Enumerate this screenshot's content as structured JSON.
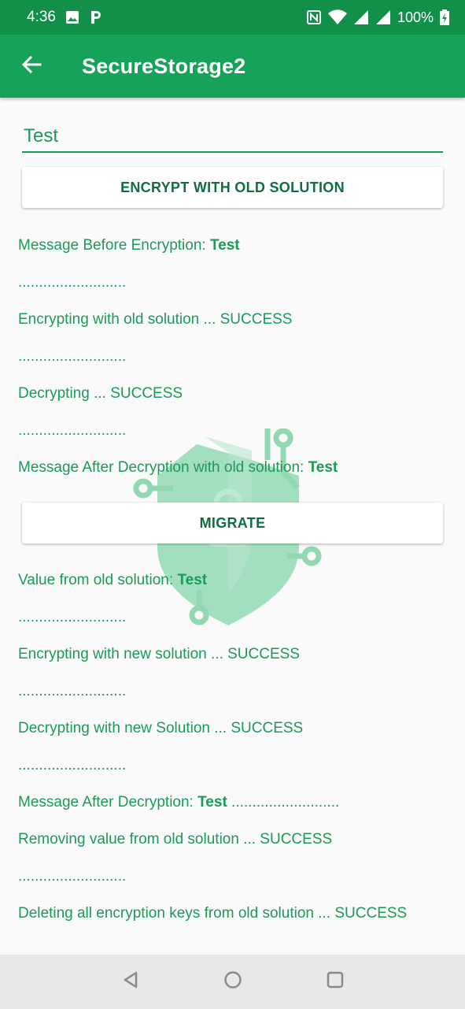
{
  "status_bar": {
    "time": "4:36",
    "battery": "100%",
    "icons": [
      "image-icon",
      "p-app-icon",
      "nfc-icon",
      "wifi-icon",
      "signal-icon",
      "signal-icon-2",
      "battery-icon"
    ]
  },
  "app_bar": {
    "title": "SecureStorage2",
    "back_icon": "arrow-back-icon"
  },
  "input": {
    "value": "Test"
  },
  "buttons": {
    "encrypt_old": "ENCRYPT WITH OLD SOLUTION",
    "migrate": "MIGRATE"
  },
  "log": {
    "line1_prefix": "Message Before Encryption: ",
    "line1_value": "Test",
    "sep": "..........................",
    "line2": "Encrypting with old solution ... SUCCESS",
    "line3": "Decrypting ... SUCCESS",
    "line4_prefix": "Message After Decryption with old solution: ",
    "line4_value": "Test",
    "line5_prefix": "Value from old solution: ",
    "line5_value": "Test",
    "line6": "Encrypting with new solution ... SUCCESS",
    "line7": "Decrypting with new Solution ... SUCCESS",
    "line8_prefix": "Message After Decryption: ",
    "line8_value": "Test",
    "line8_suffix": " ..........................",
    "line9": "Removing value from old solution ... SUCCESS",
    "line10": "Deleting all encryption keys from old solution ... SUCCESS"
  },
  "colors": {
    "status_bar": "#12904a",
    "app_bar": "#16a258",
    "accent_text": "#1a9a55",
    "button_text": "#0f6e3e",
    "background": "#fafafa",
    "nav_bar": "#e8e8e8"
  },
  "nav_bar": {
    "icons": [
      "back-triangle-icon",
      "home-circle-icon",
      "recents-square-icon"
    ]
  }
}
